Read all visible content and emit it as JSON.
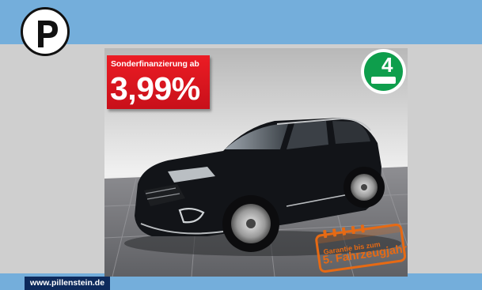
{
  "colors": {
    "header_band": "#74aedb",
    "footer_band": "#74aedb",
    "page_background": "#cfcfcf",
    "promo_red": "#e3141c",
    "badge_green": "#0e9e4c",
    "warranty_orange": "#e66a14",
    "url_box_navy": "#0d2a5c",
    "car_black": "#121418"
  },
  "header": {
    "logo_icon": "pillenstein-p-icon"
  },
  "listing_image": {
    "subject": "black SUV",
    "promo": {
      "label": "Sonderfinanzierung ab",
      "rate": "3,99%"
    },
    "emission_badge": {
      "icon": "green-environmental-badge-icon",
      "number": "4"
    },
    "warranty_stamp": {
      "icon": "calendar-stamp-icon",
      "line1": "Garantie bis zum",
      "line2": "5. Fahrzeugjahr"
    }
  },
  "footer": {
    "url": "www.pillenstein.de"
  }
}
